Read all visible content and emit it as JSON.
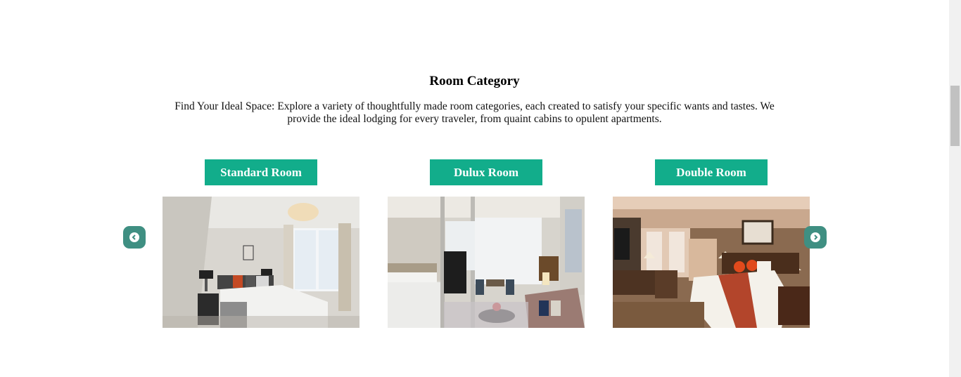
{
  "section": {
    "title": "Room Category",
    "description": "Find Your Ideal Space: Explore a variety of thoughtfully made room categories, each created to satisfy your specific wants and tastes. We provide the ideal lodging for every traveler, from quaint cabins to opulent apartments."
  },
  "rooms": [
    {
      "label": "Standard Room"
    },
    {
      "label": "Dulux Room"
    },
    {
      "label": "Double Room"
    }
  ],
  "carousel": {
    "prev_icon": "chevron-left-icon",
    "next_icon": "chevron-right-icon"
  },
  "colors": {
    "button": "#12ad8b",
    "arrow": "#3f8f82"
  }
}
